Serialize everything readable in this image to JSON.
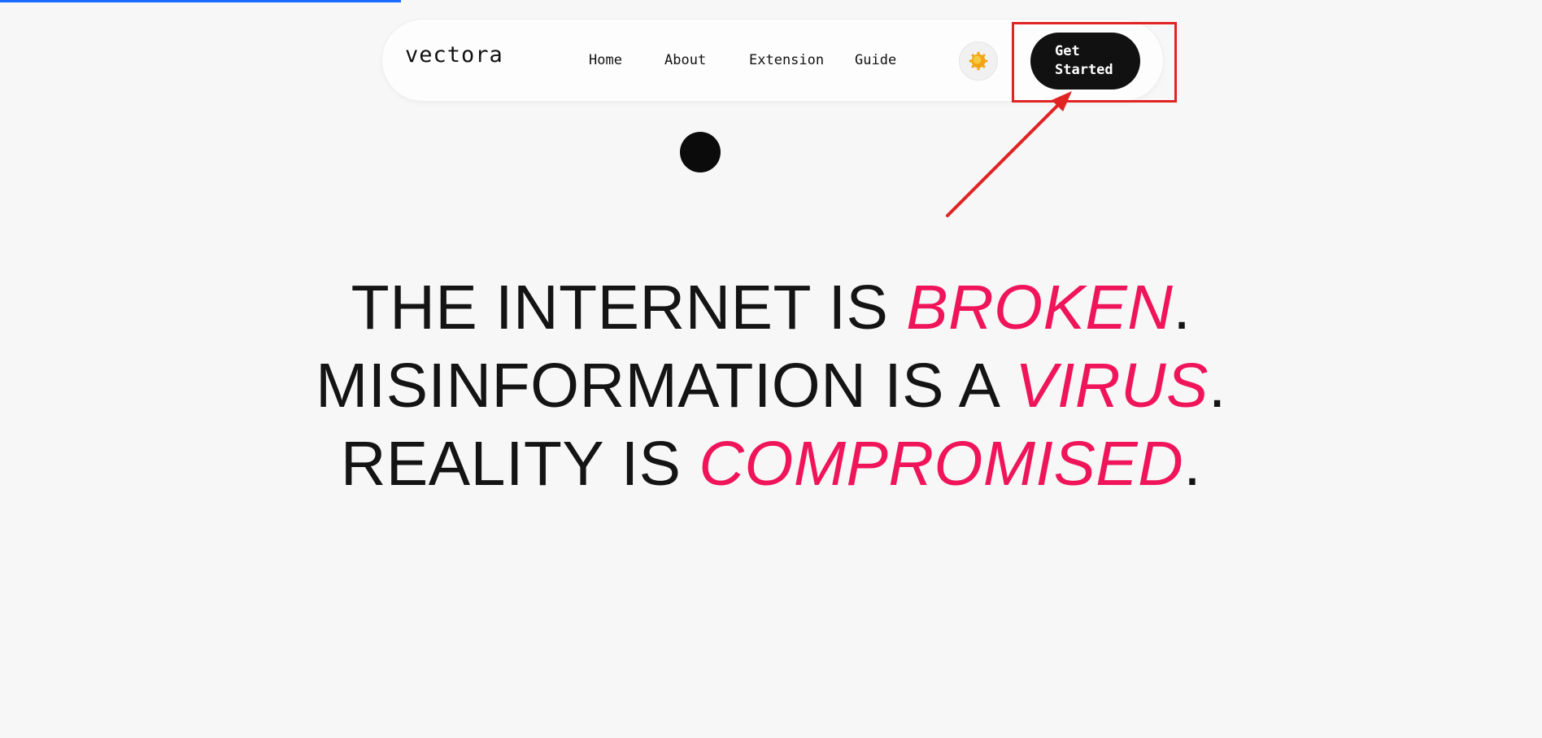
{
  "page_progress": 0.26,
  "colors": {
    "progress": "#1a6bff",
    "accent": "#f0145a",
    "text": "#141414",
    "button_bg": "#111111",
    "annotation": "#e02424"
  },
  "nav": {
    "logo": "vectora",
    "links": [
      "Home",
      "About",
      "Extension",
      "Guide"
    ],
    "theme_toggle_icon": "sun-icon",
    "cta_label": "Get\nStarted"
  },
  "hero": {
    "line1": {
      "prefix": "THE INTERNET IS ",
      "accent": "BROKEN",
      "suffix": "."
    },
    "line2": {
      "prefix": "MISINFORMATION IS A ",
      "accent": "VIRUS",
      "suffix": "."
    },
    "line3": {
      "prefix": "REALITY IS ",
      "accent": "COMPROMISED",
      "suffix": "."
    }
  }
}
